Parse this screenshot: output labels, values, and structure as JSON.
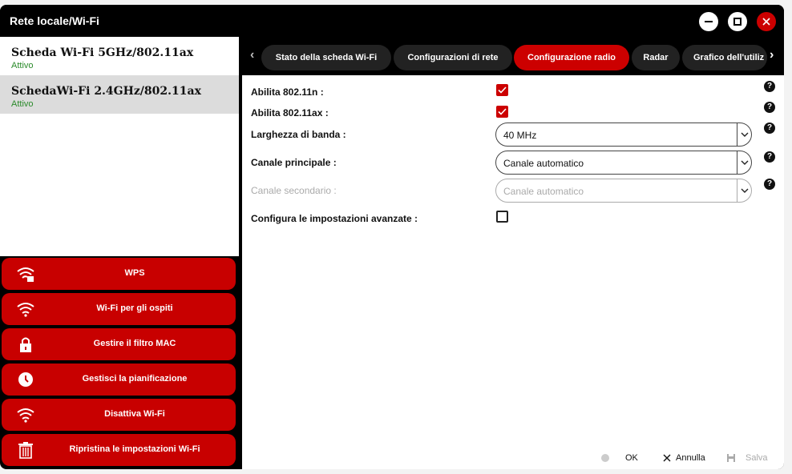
{
  "window": {
    "title": "Rete locale/Wi-Fi"
  },
  "adapters": [
    {
      "name": "Scheda Wi-Fi 5GHz/802.11ax",
      "status": "Attivo"
    },
    {
      "name": "SchedaWi-Fi 2.4GHz/802.11ax",
      "status": "Attivo"
    }
  ],
  "menu": [
    {
      "label": "WPS",
      "icon": "wifi-lock-icon"
    },
    {
      "label": "Wi-Fi per gli ospiti",
      "icon": "wifi-icon"
    },
    {
      "label": "Gestire il filtro MAC",
      "icon": "lock-icon"
    },
    {
      "label": "Gestisci la pianificazione",
      "icon": "clock-icon"
    },
    {
      "label": "Disattiva Wi-Fi",
      "icon": "wifi-icon"
    },
    {
      "label": "Ripristina le impostazioni Wi-Fi",
      "icon": "trash-icon"
    }
  ],
  "tabs": [
    {
      "label": "Stato della scheda Wi-Fi",
      "active": false
    },
    {
      "label": "Configurazioni di rete",
      "active": false
    },
    {
      "label": "Configurazione radio",
      "active": true
    },
    {
      "label": "Radar",
      "active": false
    },
    {
      "label": "Grafico dell'utiliz",
      "active": false
    }
  ],
  "form": {
    "enable_n": {
      "label": "Abilita 802.11n :",
      "checked": true
    },
    "enable_ax": {
      "label": "Abilita 802.11ax :",
      "checked": true
    },
    "bandwidth": {
      "label": "Larghezza di banda :",
      "value": "40 MHz"
    },
    "primary_channel": {
      "label": "Canale principale :",
      "value": "Canale automatico"
    },
    "secondary_channel": {
      "label": "Canale secondario :",
      "value": "Canale automatico",
      "disabled": true
    },
    "advanced": {
      "label": "Configura le impostazioni avanzate :",
      "checked": false
    }
  },
  "footer": {
    "ok": "OK",
    "cancel": "Annulla",
    "save": "Salva"
  },
  "colors": {
    "accent": "#cc0000",
    "dark": "#000000",
    "success": "#2a8a2a"
  }
}
